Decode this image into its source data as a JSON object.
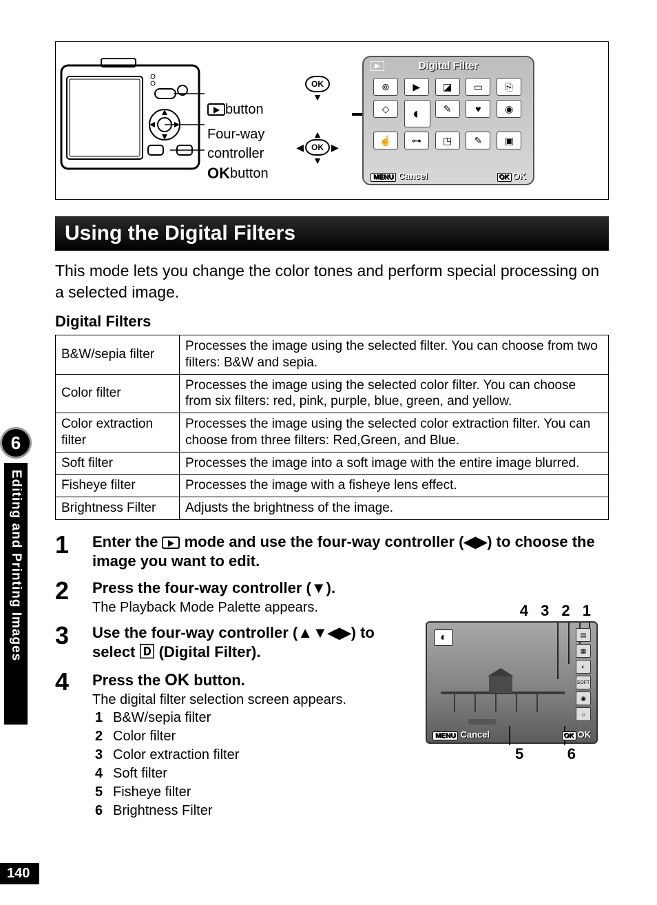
{
  "sideTab": {
    "chapter": "6",
    "label": "Editing and Printing Images"
  },
  "pageNumber": "140",
  "diagram": {
    "labels": {
      "play": " button",
      "fourway1": "Four-way",
      "fourway2": "controller",
      "ok": " button"
    },
    "lcd": {
      "title": "Digital Filter",
      "menu": "MENU",
      "cancel": "Cancel",
      "okBadge": "OK",
      "ok": "OK"
    }
  },
  "section": {
    "title": "Using the Digital Filters"
  },
  "intro": "This mode lets you change the color tones and perform special processing on a selected image.",
  "subHeading": "Digital Filters",
  "filters": [
    {
      "name": "B&W/sepia filter",
      "desc": "Processes the image using the selected filter. You can choose from two filters: B&W and sepia."
    },
    {
      "name": "Color filter",
      "desc": "Processes the image using the selected color filter. You can choose from six filters: red, pink, purple, blue, green, and yellow."
    },
    {
      "name": "Color extraction filter",
      "desc": "Processes the image using the selected color extraction filter. You can choose from three filters: Red,Green, and Blue."
    },
    {
      "name": "Soft filter",
      "desc": "Processes the image into a soft image with the entire image blurred."
    },
    {
      "name": "Fisheye filter",
      "desc": "Processes the image with a fisheye lens effect."
    },
    {
      "name": "Brightness Filter",
      "desc": "Adjusts the brightness of the image."
    }
  ],
  "steps": [
    {
      "n": "1",
      "title_a": "Enter the ",
      "title_b": " mode and use the four-way controller (◀▶) to choose the image you want to edit."
    },
    {
      "n": "2",
      "title": "Press the four-way controller (▼).",
      "desc": "The Playback Mode Palette appears."
    },
    {
      "n": "3",
      "title": "Use the four-way controller (▲▼◀▶) to select 🄳 (Digital Filter)."
    },
    {
      "n": "4",
      "title_a": "Press the ",
      "title_ok": "OK",
      "title_b": " button.",
      "desc": "The digital filter selection screen appears.",
      "list": [
        {
          "n": "1",
          "t": "B&W/sepia filter"
        },
        {
          "n": "2",
          "t": "Color filter"
        },
        {
          "n": "3",
          "t": "Color extraction filter"
        },
        {
          "n": "4",
          "t": "Soft filter"
        },
        {
          "n": "5",
          "t": "Fisheye filter"
        },
        {
          "n": "6",
          "t": "Brightness Filter"
        }
      ]
    }
  ],
  "fig2": {
    "callout": "4 3 2 1",
    "menu": "MENU",
    "cancel": "Cancel",
    "okBadge": "OK",
    "ok": "OK",
    "legend5": "5",
    "legend6": "6",
    "soft": "SOFT"
  }
}
